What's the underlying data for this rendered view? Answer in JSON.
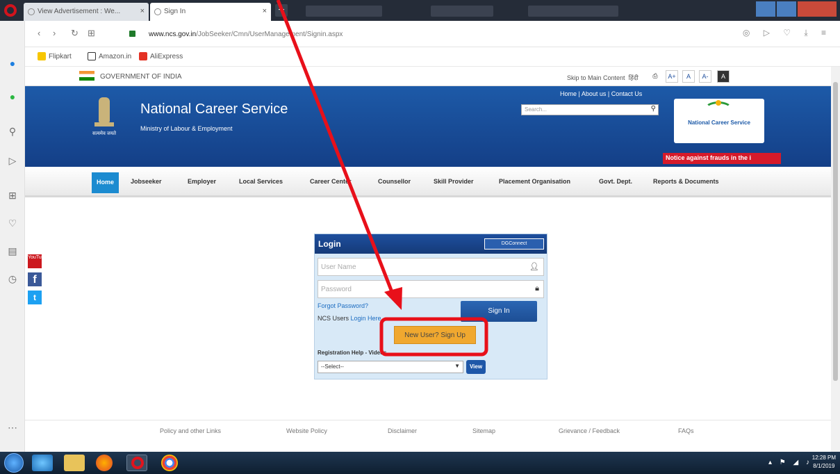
{
  "browser": {
    "tabs": [
      {
        "label": "View Advertisement : We..."
      },
      {
        "label": "Sign In"
      }
    ],
    "url_domain": "www.ncs.gov.in",
    "url_path": "/JobSeeker/Cmn/UserManagement/Signin.aspx",
    "bookmarks": [
      "Flipkart",
      "Amazon.in",
      "AliExpress"
    ]
  },
  "site": {
    "gov_label": "GOVERNMENT OF INDIA",
    "skip_link": "Skip to Main Content",
    "hindi_link": "हिंदी",
    "font_btns": [
      "A+",
      "A",
      "A-",
      "A"
    ],
    "top_links": "Home | About us | Contact Us",
    "search_placeholder": "Search...",
    "title": "National Career Service",
    "subtitle": "Ministry of Labour & Employment",
    "emblem_caption": "सत्यमेव जयते",
    "logo_text": "National Career Service",
    "notice": "Notice against frauds in the i"
  },
  "menu": [
    "Home",
    "Jobseeker",
    "Employer",
    "Local Services",
    "Career Center",
    "Counsellor",
    "Skill Provider",
    "Placement Organisation",
    "Govt. Dept.",
    "Reports & Documents"
  ],
  "login": {
    "title": "Login",
    "digilocker": "DGConnect",
    "username_placeholder": "User Name",
    "password_placeholder": "Password",
    "forgot": "Forgot Password?",
    "ncs_users": "NCS Users",
    "ncs_login_link": "Login Here",
    "signin": "Sign In",
    "signup": "New User? Sign Up",
    "reg_help": "Registration Help - Videos",
    "select_value": "--Select--",
    "view": "View"
  },
  "social": [
    "YouTube",
    "f",
    "t"
  ],
  "footer": [
    "Policy and other Links",
    "Website Policy",
    "Disclaimer",
    "Sitemap",
    "Grievance / Feedback",
    "FAQs"
  ],
  "taskbar": {
    "time": "12:28 PM",
    "date": "8/1/2019"
  },
  "colors": {
    "banner": "#1d5aa8",
    "menu_active": "#1c8bd0",
    "signup": "#f0a82f",
    "annotation": "#e8101a"
  }
}
